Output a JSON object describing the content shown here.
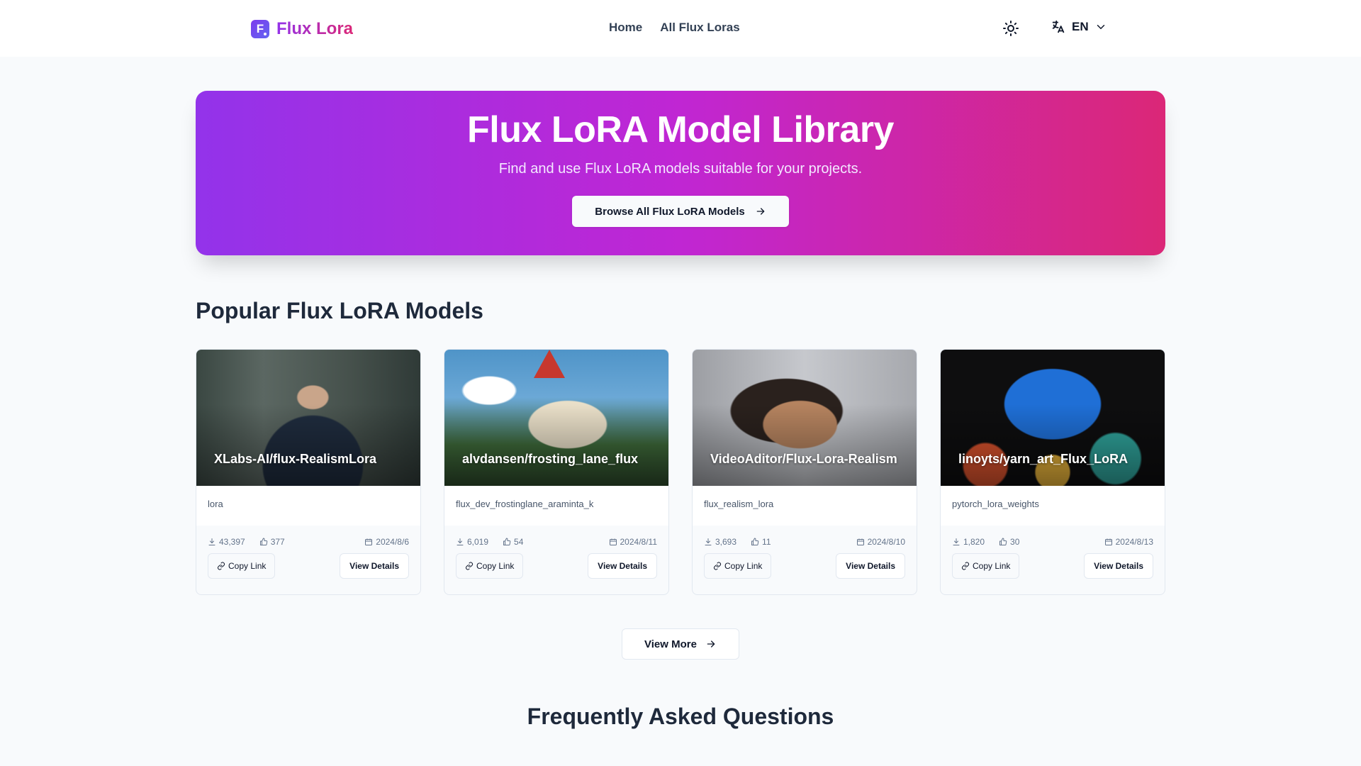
{
  "header": {
    "logo_letter": "F",
    "brand": "Flux Lora",
    "nav": [
      {
        "label": "Home"
      },
      {
        "label": "All Flux Loras"
      }
    ],
    "theme_icon": "sun-icon",
    "language": "EN"
  },
  "hero": {
    "title": "Flux LoRA Model Library",
    "subtitle": "Find and use Flux LoRA models suitable for your projects.",
    "cta_label": "Browse All Flux LoRA Models"
  },
  "popular": {
    "title": "Popular Flux LoRA Models",
    "cards": [
      {
        "name": "XLabs-AI/flux-RealismLora",
        "file": "lora",
        "downloads": "43,397",
        "likes": "377",
        "date": "2024/8/6",
        "copy_label": "Copy Link",
        "details_label": "View Details"
      },
      {
        "name": "alvdansen/frosting_lane_flux",
        "file": "flux_dev_frostinglane_araminta_k",
        "downloads": "6,019",
        "likes": "54",
        "date": "2024/8/11",
        "copy_label": "Copy Link",
        "details_label": "View Details"
      },
      {
        "name": "VideoAditor/Flux-Lora-Realism",
        "file": "flux_realism_lora",
        "downloads": "3,693",
        "likes": "11",
        "date": "2024/8/10",
        "copy_label": "Copy Link",
        "details_label": "View Details"
      },
      {
        "name": "linoyts/yarn_art_Flux_LoRA",
        "file": "pytorch_lora_weights",
        "downloads": "1,820",
        "likes": "30",
        "date": "2024/8/13",
        "copy_label": "Copy Link",
        "details_label": "View Details"
      }
    ],
    "view_more_label": "View More"
  },
  "faq": {
    "title": "Frequently Asked Questions"
  },
  "colors": {
    "gradient_start": "#9333ea",
    "gradient_mid": "#c026d3",
    "gradient_end": "#db2777",
    "background": "#f8fafc"
  }
}
